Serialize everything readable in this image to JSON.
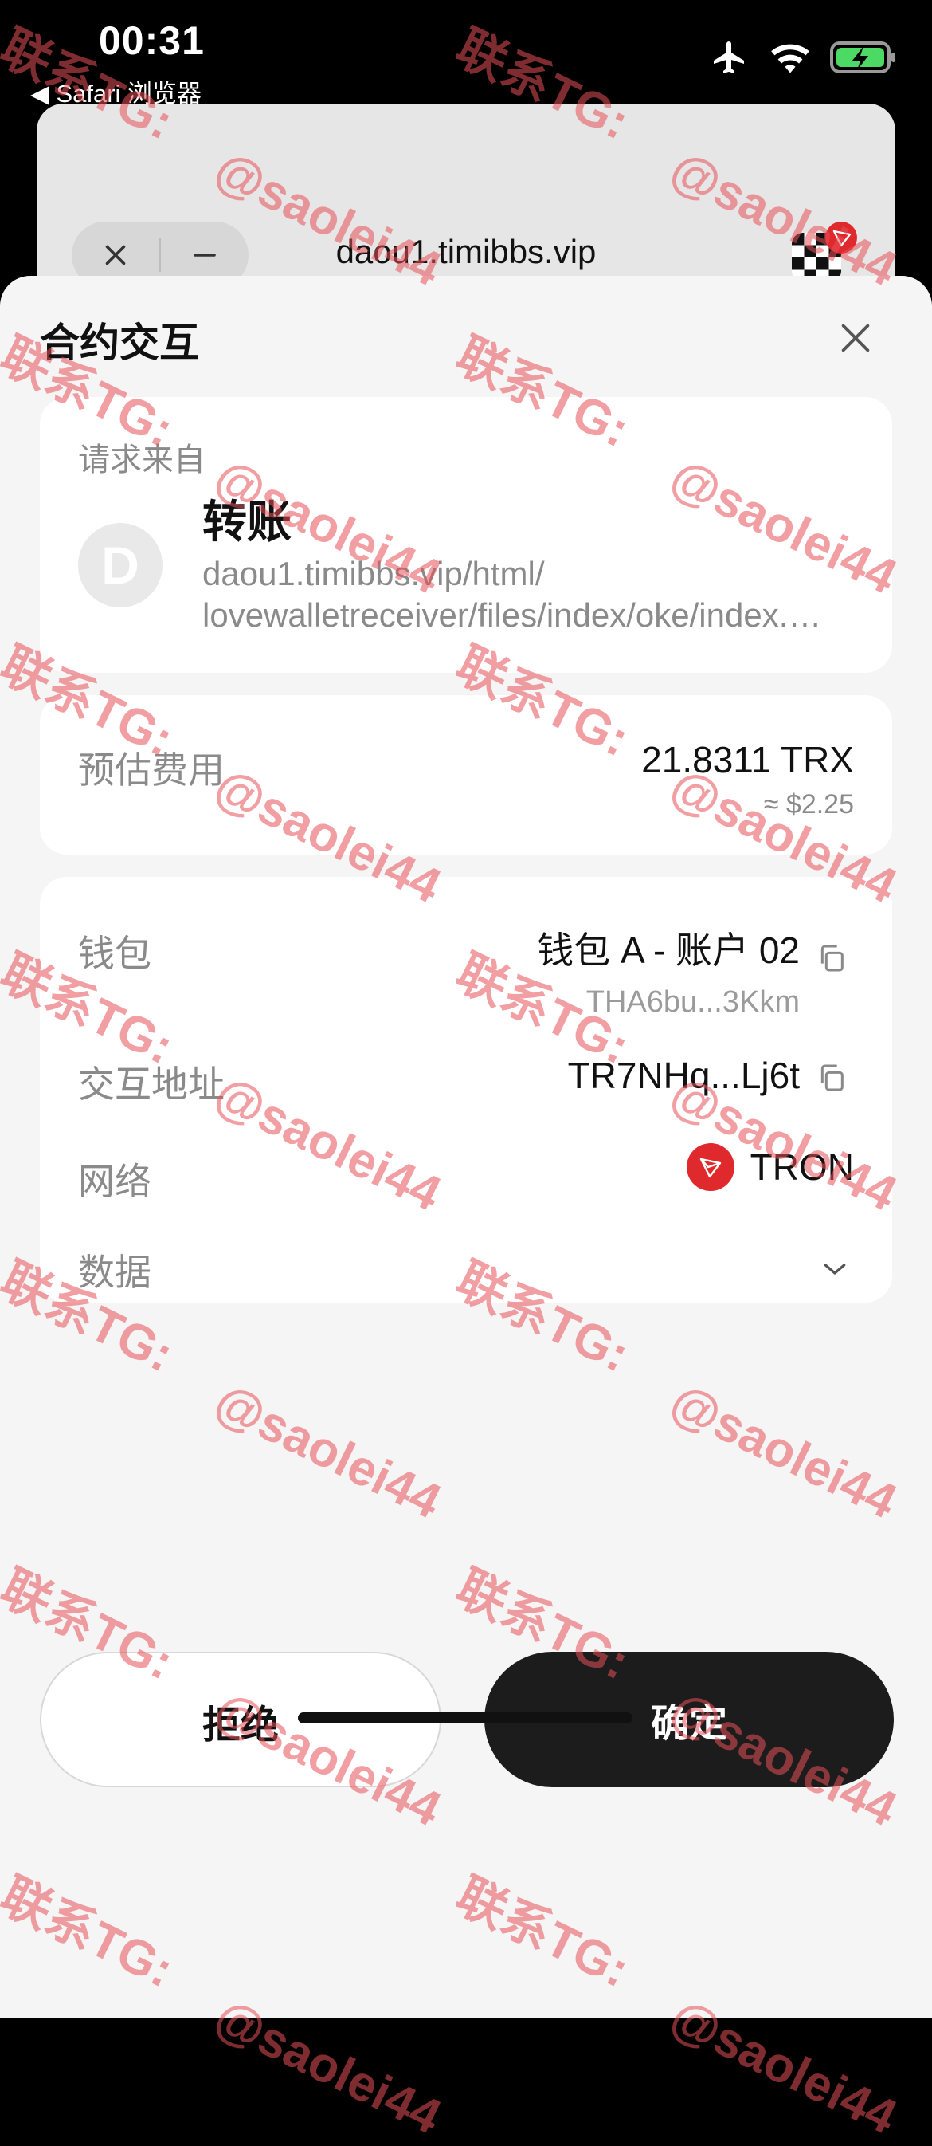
{
  "status_bar": {
    "time": "00:31",
    "back_app": "◀ Safari 浏览器",
    "battery_color": "#4cd964"
  },
  "browser": {
    "url": "daou1.timibbs.vip"
  },
  "sheet": {
    "title": "合约交互",
    "request_from_label": "请求来自",
    "origin": {
      "avatar_letter": "D",
      "title": "转账",
      "url_line1": "daou1.timibbs.vip/html/",
      "url_line2": "lovewalletreceiver/files/index/oke/index.html"
    },
    "fee": {
      "label": "预估费用",
      "amount": "21.8311 TRX",
      "usd": "≈ $2.25"
    },
    "details": {
      "wallet_label": "钱包",
      "wallet_name": "钱包 A - 账户 02",
      "wallet_address": "THA6bu...3Kkm",
      "contract_label": "交互地址",
      "contract_address": "TR7NHq...Lj6t",
      "network_label": "网络",
      "network_name": "TRON",
      "data_label": "数据"
    }
  },
  "buttons": {
    "reject": "拒绝",
    "confirm": "确定"
  },
  "watermark": {
    "line1": "联系TG:",
    "line2": "@saolei44",
    "color": "#e8505a"
  },
  "colors": {
    "tron_red": "#e0292d",
    "confirm_bg": "#1c1c1c"
  }
}
